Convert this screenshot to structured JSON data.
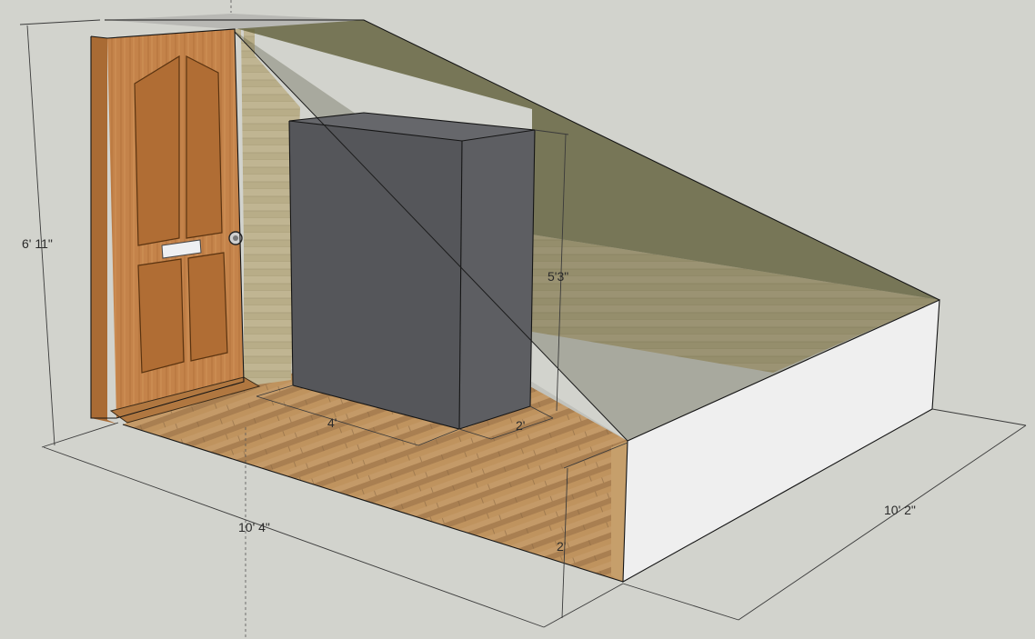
{
  "dimensions": {
    "room_height": "6' 11\"",
    "room_width": "10' 4\"",
    "room_depth": "10' 2\"",
    "cabinet_height": "5'3\"",
    "cabinet_width": "4'",
    "cabinet_depth": "2'",
    "knee_wall_height": "2'"
  },
  "colors": {
    "background": "#d2d3cd",
    "floor_wood": "#b98e5c",
    "wall_panel": "#b7ab86",
    "slope_overlay": "#5e5c36",
    "cabinet_front": "#55565a",
    "cabinet_side": "#5d5e62",
    "cabinet_top": "#66676b",
    "knee_wall": "#efefef",
    "door_wood": "#c07f44"
  }
}
